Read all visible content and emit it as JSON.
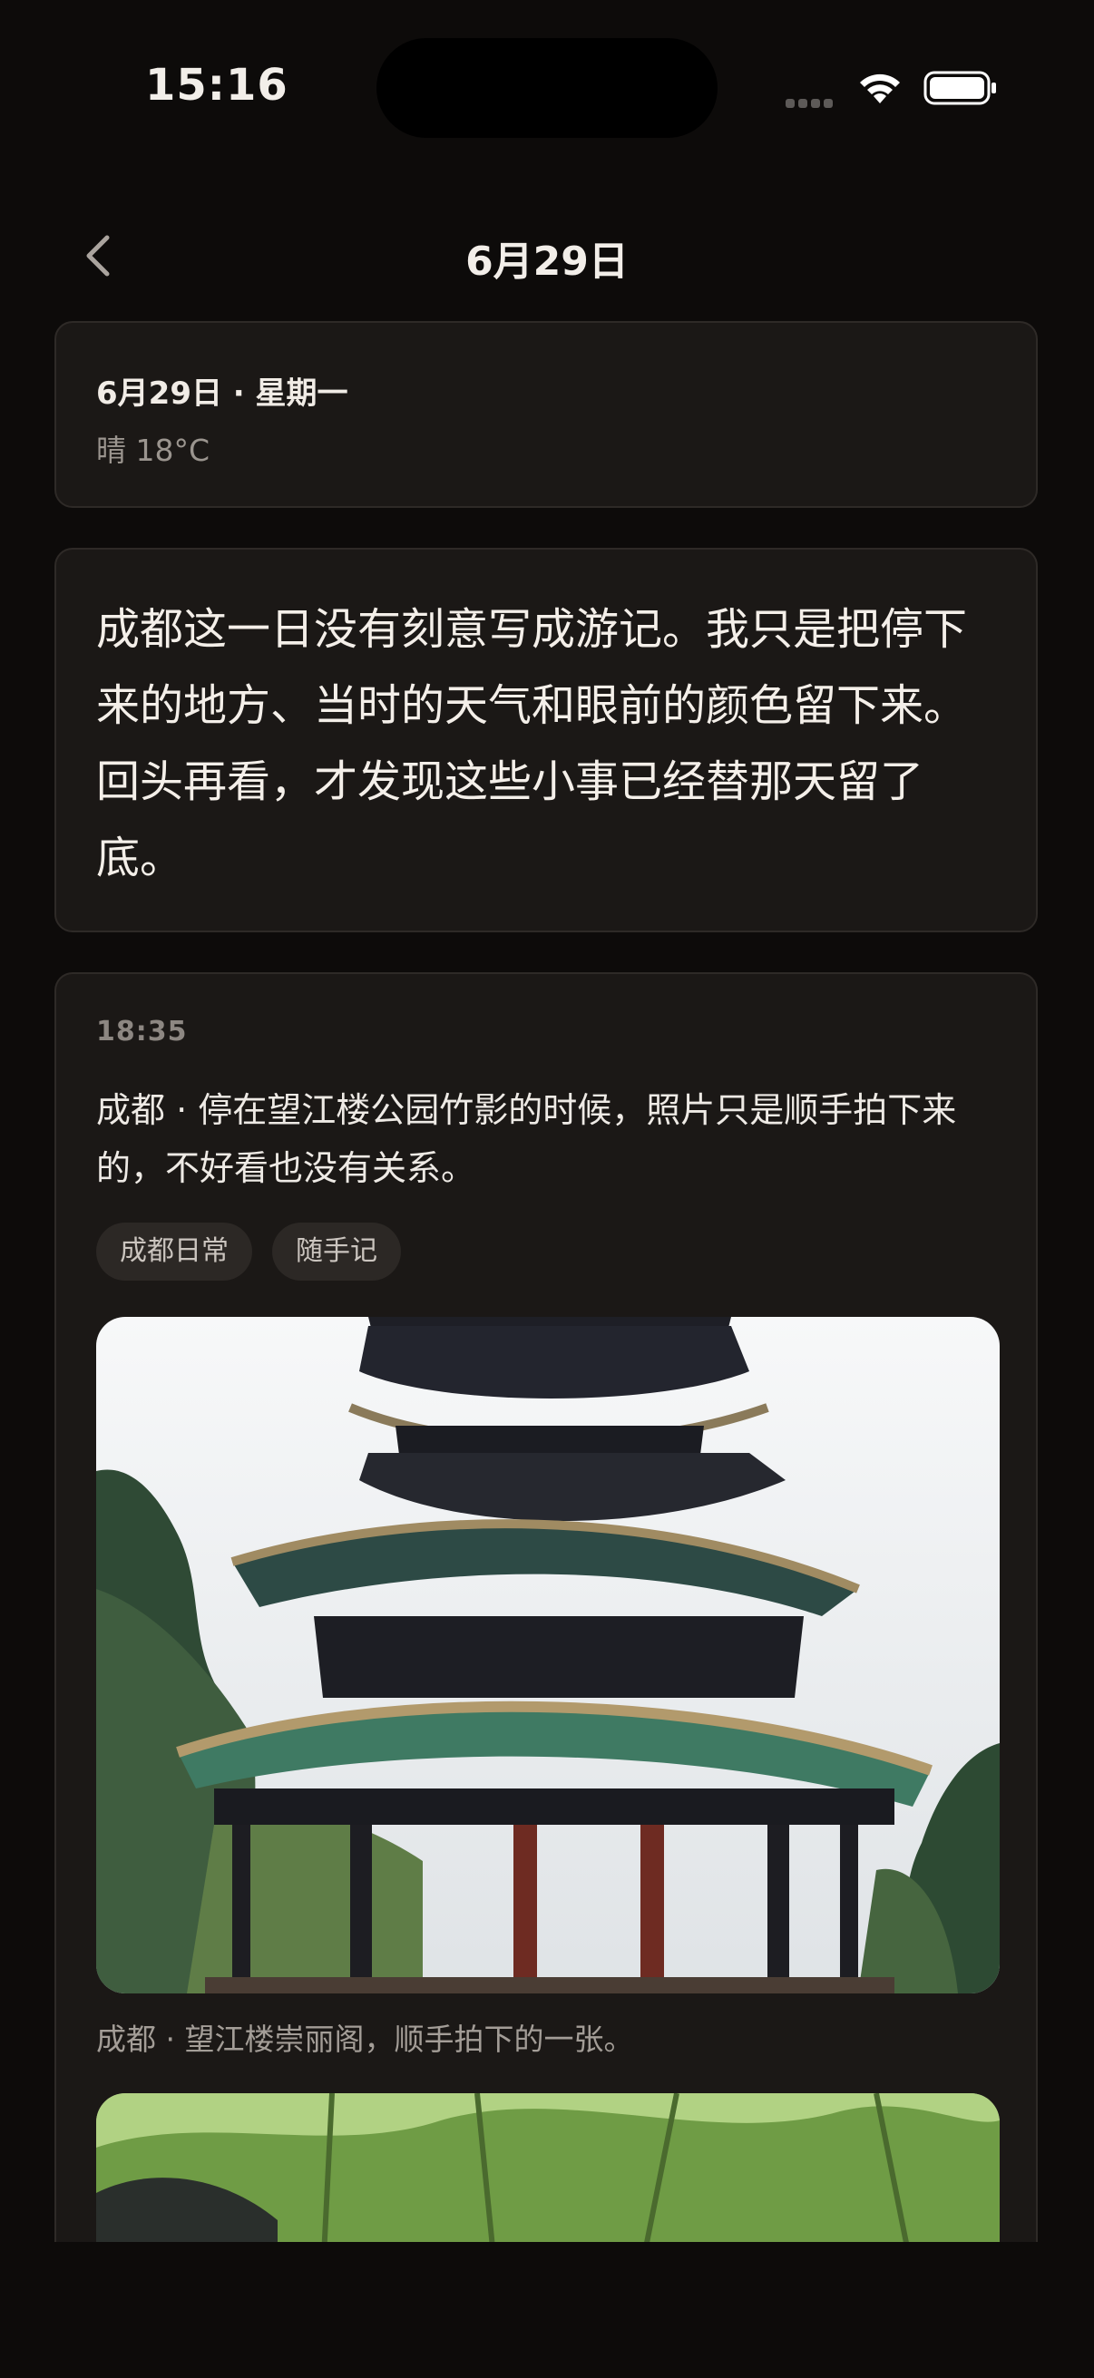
{
  "status_bar": {
    "time": "15:16"
  },
  "nav": {
    "title": "6月29日",
    "back_icon": "chevron-left-icon"
  },
  "day": {
    "date_line": "6月29日 · 星期一",
    "weather": "晴 18°C"
  },
  "intro": {
    "text": "成都这一日没有刻意写成游记。我只是把停下来的地方、当时的天气和眼前的颜色留下来。回头再看，才发现这些小事已经替那天留了底。"
  },
  "entry": {
    "time": "18:35",
    "text": "成都 · 停在望江楼公园竹影的时候，照片只是顺手拍下来的，不好看也没有关系。",
    "tags": [
      "成都日常",
      "随手记"
    ],
    "photo_caption": "成都 · 望江楼崇丽阁，顺手拍下的一张。"
  },
  "colors": {
    "background": "#0d0b0a",
    "card": "#1b1816",
    "text": "#f2eee9",
    "muted": "#9b958f"
  }
}
